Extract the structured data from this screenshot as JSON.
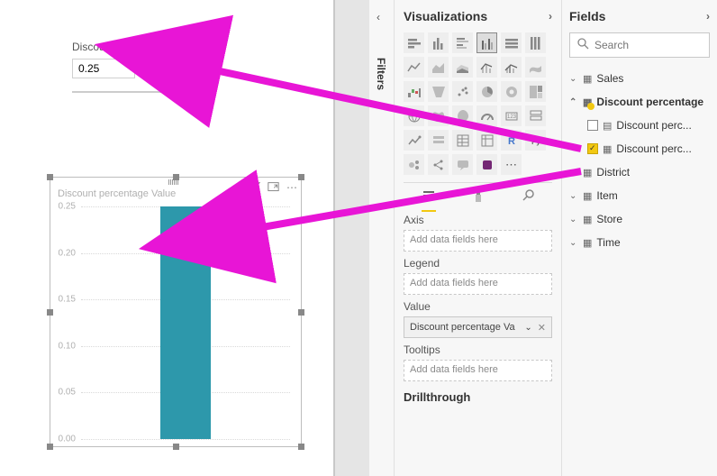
{
  "slicer": {
    "label": "Discount percentage",
    "value": "0.25"
  },
  "chart": {
    "title": "Discount percentage Value",
    "ticks": [
      "0.25",
      "0.20",
      "0.15",
      "0.10",
      "0.05",
      "0.00"
    ]
  },
  "chart_data": {
    "type": "bar",
    "categories": [
      "Discount percentage Value"
    ],
    "values": [
      0.25
    ],
    "title": "Discount percentage Value",
    "xlabel": "",
    "ylabel": "",
    "ylim": [
      0,
      0.25
    ]
  },
  "filters": {
    "label": "Filters"
  },
  "viz": {
    "header": "Visualizations",
    "chevron": "›",
    "axis_label": "Axis",
    "axis_placeholder": "Add data fields here",
    "legend_label": "Legend",
    "legend_placeholder": "Add data fields here",
    "value_label": "Value",
    "value_chip": "Discount percentage Va",
    "tooltips_label": "Tooltips",
    "tooltips_placeholder": "Add data fields here",
    "drill_label": "Drillthrough"
  },
  "fields": {
    "header": "Fields",
    "chevron": "›",
    "search_placeholder": "Search",
    "tables": {
      "sales": "Sales",
      "discount_pct": "Discount percentage",
      "discount_col1": "Discount perc...",
      "discount_col2": "Discount perc...",
      "district": "District",
      "item": "Item",
      "store": "Store",
      "time": "Time"
    }
  }
}
